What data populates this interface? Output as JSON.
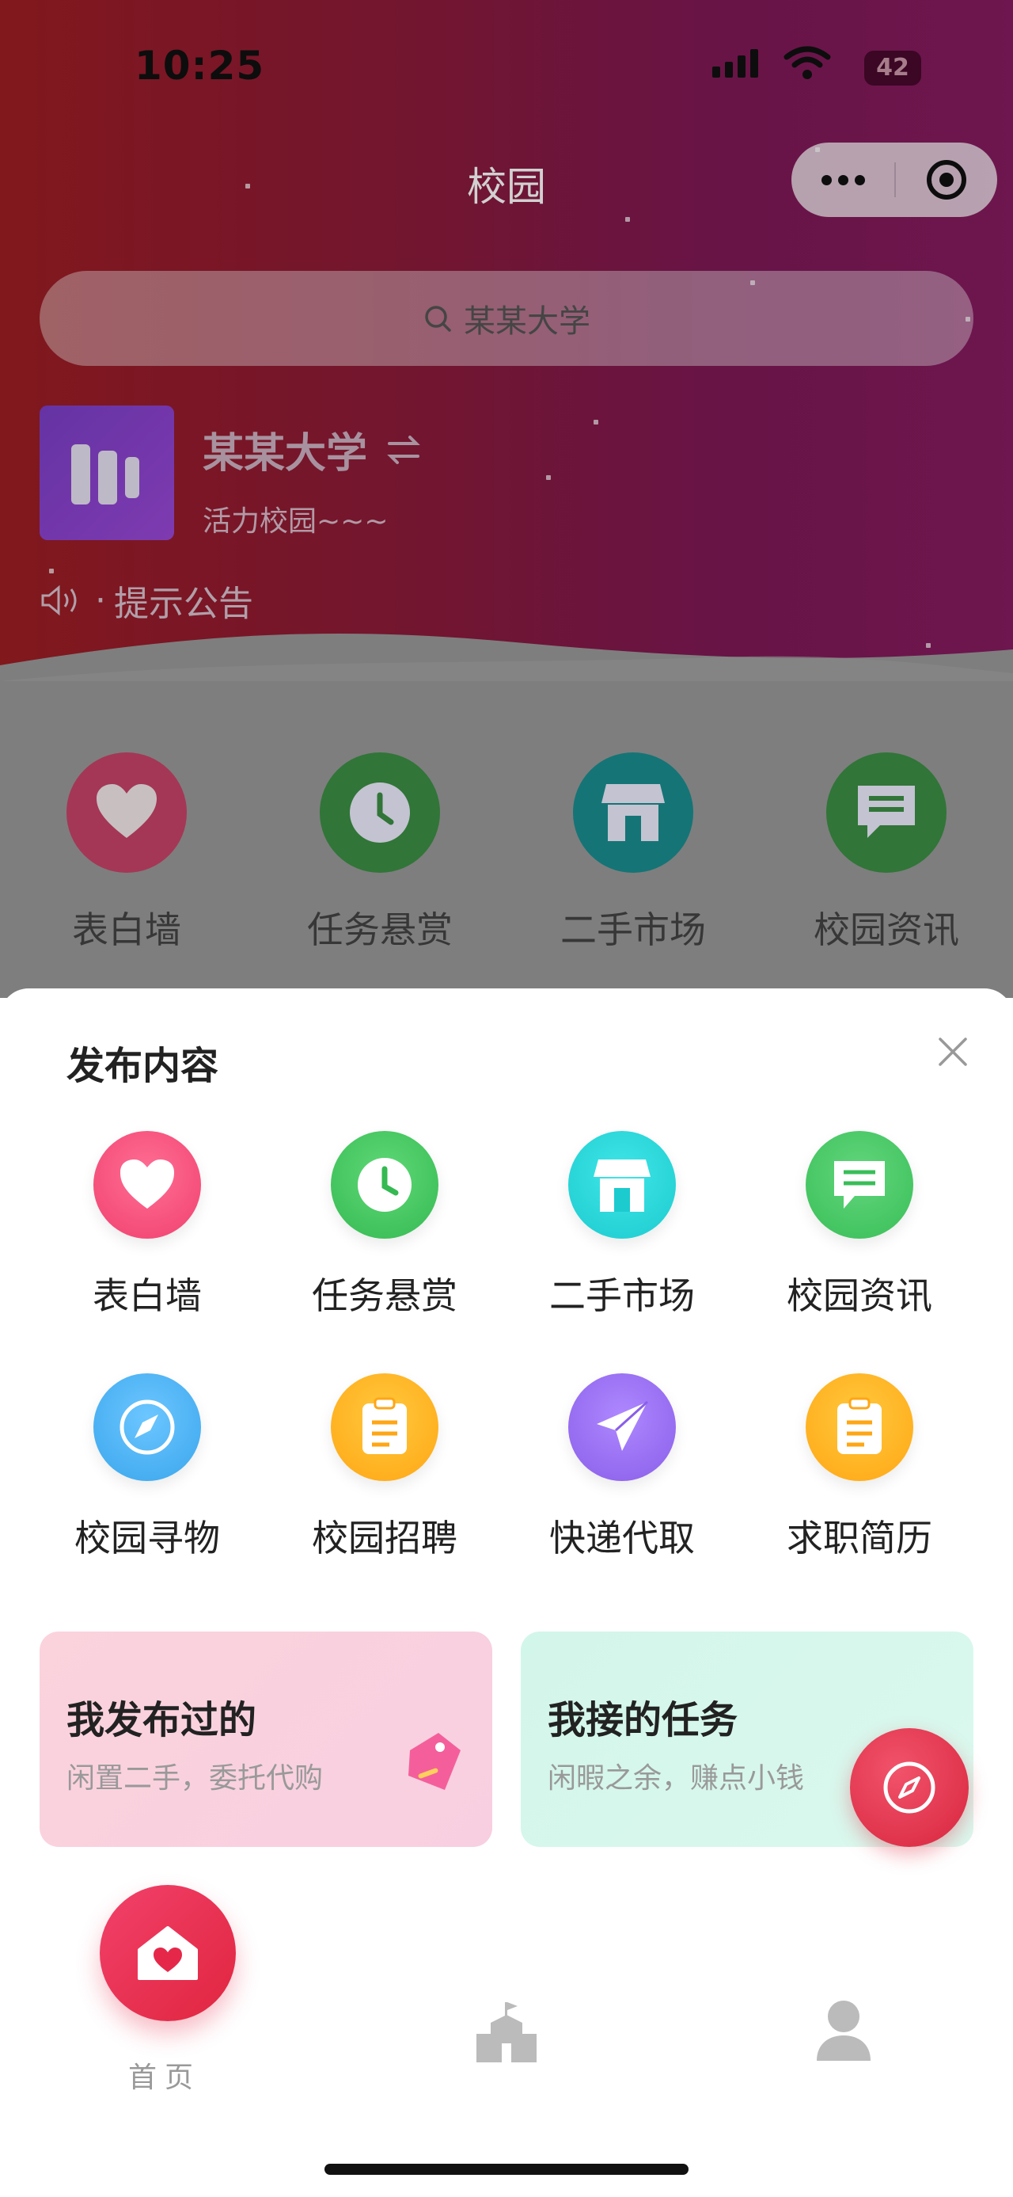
{
  "status_bar": {
    "time": "10:25",
    "battery": "42"
  },
  "header": {
    "title": "校园",
    "search_text": "某某大学",
    "school_name": "某某大学",
    "school_slogan": "活力校园~~~",
    "notice": "提示公告"
  },
  "background_nav": [
    {
      "label": "表白墙",
      "icon": "heart-icon",
      "color": "#e24a72"
    },
    {
      "label": "任务悬赏",
      "icon": "clock-icon",
      "color": "#3aa34a"
    },
    {
      "label": "二手市场",
      "icon": "shop-icon",
      "color": "#1fa6a8"
    },
    {
      "label": "校园资讯",
      "icon": "message-icon",
      "color": "#3aa34a"
    }
  ],
  "sheet": {
    "title": "发布内容",
    "items": [
      {
        "label": "表白墙",
        "icon": "heart-icon",
        "color": "#f64f7e"
      },
      {
        "label": "任务悬赏",
        "icon": "clock-icon",
        "color": "#3ec35c"
      },
      {
        "label": "二手市场",
        "icon": "shop-icon",
        "color": "#25d3d6"
      },
      {
        "label": "校园资讯",
        "icon": "message-icon",
        "color": "#41c561"
      },
      {
        "label": "校园寻物",
        "icon": "compass-icon",
        "color": "#4ab3f5"
      },
      {
        "label": "校园招聘",
        "icon": "clipboard-icon",
        "color": "#ffb41e"
      },
      {
        "label": "快递代取",
        "icon": "paper-plane-icon",
        "color": "#9b6df3"
      },
      {
        "label": "求职简历",
        "icon": "clipboard-icon",
        "color": "#ffb41e"
      }
    ],
    "cards": [
      {
        "title": "我发布过的",
        "subtitle": "闲置二手，委托代购"
      },
      {
        "title": "我接的任务",
        "subtitle": "闲暇之余，赚点小钱"
      }
    ]
  },
  "tabbar": {
    "home_label": "首页"
  }
}
